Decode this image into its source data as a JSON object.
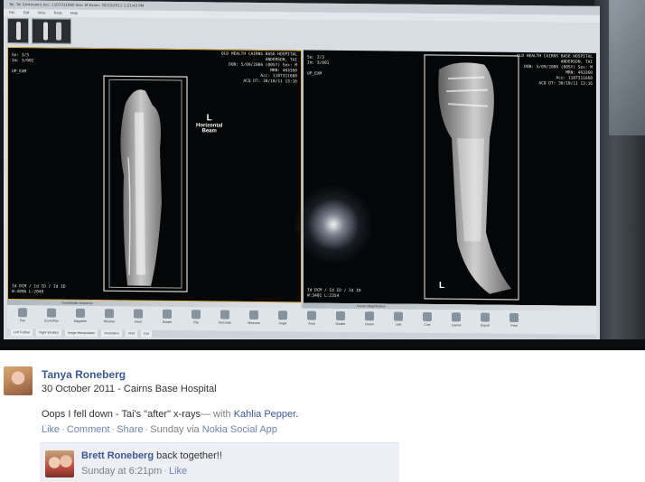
{
  "monitor": {
    "titlebar_text": "Tai, Tai (Unknown)  Acc: 1107311660  Sex: M  Exam: 30/10/2011 1:23:43 PM",
    "menu": [
      "File",
      "Edit",
      "View",
      "Tools",
      "Help"
    ],
    "left_pane": {
      "info_tl": "Se: 3/3\nIm: 3/002\n\nUP_EXM",
      "info_tr": "QLD HEALTH CAIRNS BASE HOSPITAL\nANDERSON, TAI\nDOB: 5/09/2006 (005Y) Sex: M\nMRN: 463360\nAcc: 1107311660\nACQ DT: 30/10/11 13:16",
      "info_bl": "Id DCM / Id ID / Id ID\nW:4096 L:2048",
      "marker_letter": "L",
      "marker_caption": "Horizontal\nBeam"
    },
    "right_pane": {
      "info_tl": "Se: 2/3\nIm: 3/001\n\nUP_EXM",
      "info_tr": "QLD HEALTH CAIRNS BASE HOSPITAL\nANDERSON, TAI\nDOB: 5/09/2006 (005Y) Sex: M\nMRN: 463360\nAcc: 1107311660\nACQ DT: 30/10/11 13:16",
      "info_bl": "Id DCM / Id ID / Id ID\nW:3401 L:2354",
      "marker_letter": "L"
    },
    "strip_labels": [
      "Thumbnails Sequence",
      "Cursor Magnification"
    ],
    "tools": [
      "Pan",
      "Zoom/Pan",
      "Magnifier",
      "Window",
      "Invert",
      "Rotate",
      "Flip",
      "Annotate",
      "Measure",
      "Angle",
      "Area",
      "Shutter",
      "Reset",
      "Link",
      "Cine",
      "Layout",
      "Export",
      "Print"
    ],
    "status_tabs": [
      "Left Toolbar",
      "Right Worklist",
      "Image Manipulation",
      "Annotation",
      "Print",
      "Exit"
    ]
  },
  "post": {
    "author": "Tanya Roneberg",
    "date_location": "30 October 2011 - Cairns Base Hospital",
    "text": "Oops I fell down - Tai's \"after\" x-rays",
    "with_prefix": "— with",
    "tagged": "Kahlia Pepper",
    "text_suffix": ".",
    "actions": {
      "like": "Like",
      "comment": "Comment",
      "share": "Share",
      "posted_via": "Sunday via",
      "app": "Nokia Social App"
    },
    "reply": {
      "author": "Brett Roneberg",
      "text": "back together!!",
      "time": "Sunday at 6:21pm",
      "like": "Like"
    }
  }
}
